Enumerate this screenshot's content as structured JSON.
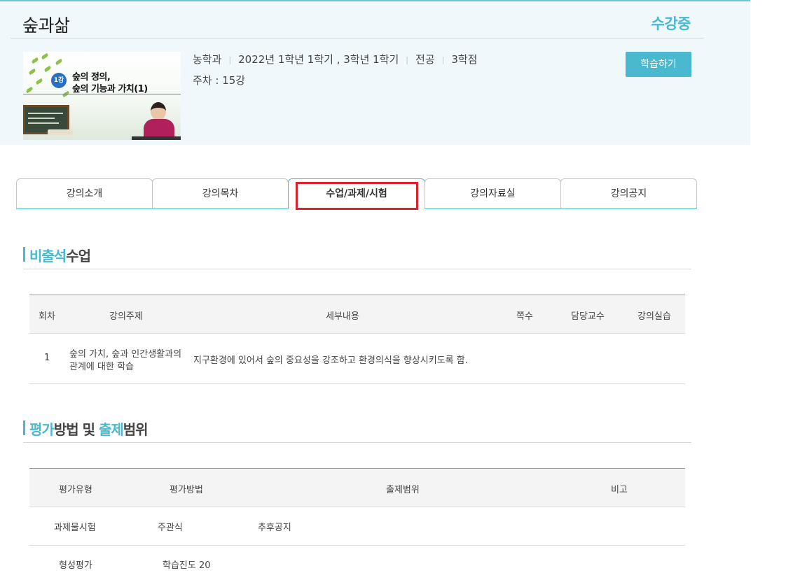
{
  "course": {
    "title": "숲과삶",
    "status": "수강중",
    "department": "농학과",
    "term": "2022년  1학년 1학기 , 3학년 1학기",
    "category": "전공",
    "credits": "3학점",
    "week_info": "주차 : 15강",
    "study_button_label": "학습하기"
  },
  "thumbnail": {
    "badge": "1강",
    "line1": "숲의 정의,",
    "line2": "숲의 기능과 가치(1)"
  },
  "tabs": [
    {
      "label": "강의소개",
      "active": false
    },
    {
      "label": "강의목차",
      "active": false
    },
    {
      "label": "수업/과제/시험",
      "active": true
    },
    {
      "label": "강의자료실",
      "active": false
    },
    {
      "label": "강의공지",
      "active": false
    }
  ],
  "section1": {
    "title_accent": "비출석",
    "title_rest": "수업",
    "columns": [
      "회차",
      "강의주제",
      "세부내용",
      "쪽수",
      "담당교수",
      "강의실습"
    ],
    "rows": [
      {
        "session": "1",
        "topic_line1": "숲의 가치, 숲과 인간생활과의",
        "topic_line2": "관계에 대한 학습",
        "detail": "지구환경에 있어서 숲의 중요성을 강조하고 환경의식을 향상시키도록 함.",
        "pages": "",
        "professor": "",
        "practice": ""
      }
    ]
  },
  "section2": {
    "title_accent1": "평가",
    "title_mid": "방법 및 ",
    "title_accent2": "출제",
    "title_rest": "범위",
    "columns": [
      "평가유형",
      "평가방법",
      "출제범위",
      "비고"
    ],
    "rows": [
      {
        "type": "과제물시험",
        "method": "주관식",
        "scope": "추후공지",
        "note": ""
      },
      {
        "type": "형성평가",
        "method": "학습진도 20",
        "scope": "",
        "note": ""
      }
    ]
  },
  "colors": {
    "accent": "#4ab8cf",
    "highlight_box": "#d9232f",
    "header_bg": "#f1f8fb"
  }
}
